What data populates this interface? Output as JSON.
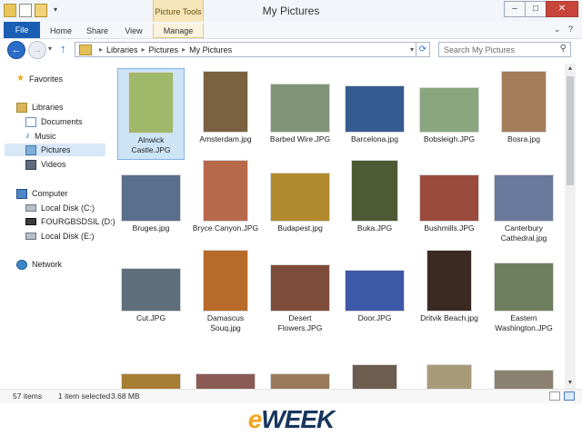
{
  "window": {
    "title": "My Pictures"
  },
  "ribbon": {
    "contextual_group": "Picture Tools",
    "tabs": [
      "File",
      "Home",
      "Share",
      "View",
      "Manage"
    ]
  },
  "address": {
    "crumbs": [
      "Libraries",
      "Pictures",
      "My Pictures"
    ]
  },
  "search": {
    "placeholder": "Search My Pictures"
  },
  "navpane": {
    "favorites": "Favorites",
    "libraries": "Libraries",
    "documents": "Documents",
    "music": "Music",
    "pictures": "Pictures",
    "videos": "Videos",
    "computer": "Computer",
    "disk_c": "Local Disk (C:)",
    "disk_d": "FOURGBSDSIL (D:)",
    "disk_e": "Local Disk (E:)",
    "network": "Network"
  },
  "files": [
    {
      "name": "Alnwick Castle.JPG",
      "color": "#9fb869",
      "selected": true
    },
    {
      "name": "Amsterdam.jpg",
      "color": "#7a6140"
    },
    {
      "name": "Barbed Wire.JPG",
      "color": "#7f9477"
    },
    {
      "name": "Barcelona.jpg",
      "color": "#355c90"
    },
    {
      "name": "Bobsleigh.JPG",
      "color": "#8aa67e"
    },
    {
      "name": "Bosra.jpg",
      "color": "#a47d5a"
    },
    {
      "name": "Bruges.jpg",
      "color": "#5a6f8e"
    },
    {
      "name": "Bryce Canyon.JPG",
      "color": "#b9694b"
    },
    {
      "name": "Budapest.jpg",
      "color": "#b08a2c"
    },
    {
      "name": "Buka.JPG",
      "color": "#4d5a34"
    },
    {
      "name": "Bushmills.JPG",
      "color": "#9a4b3e"
    },
    {
      "name": "Canterbury Cathedral.jpg",
      "color": "#6a7a9d"
    },
    {
      "name": "Cut.JPG",
      "color": "#5d6f7c"
    },
    {
      "name": "Damascus Souq.jpg",
      "color": "#b86a2a"
    },
    {
      "name": "Desert Flowers.JPG",
      "color": "#7d4c3a"
    },
    {
      "name": "Door.JPG",
      "color": "#3e58a8"
    },
    {
      "name": "Dritvik Beach.jpg",
      "color": "#3b2a22"
    },
    {
      "name": "Eastern Washington.JPG",
      "color": "#6f7e5f"
    },
    {
      "name": "",
      "color": "#a77d34"
    },
    {
      "name": "",
      "color": "#8a5a54"
    },
    {
      "name": "",
      "color": "#9a7a5c"
    },
    {
      "name": "",
      "color": "#6c5d4e"
    },
    {
      "name": "",
      "color": "#a89b7a"
    },
    {
      "name": "",
      "color": "#8b8170"
    }
  ],
  "status": {
    "count": "57 items",
    "selected": "1 item selected",
    "size": "3.68 MB"
  },
  "logo": {
    "e": "e",
    "rest": "WEEK"
  }
}
